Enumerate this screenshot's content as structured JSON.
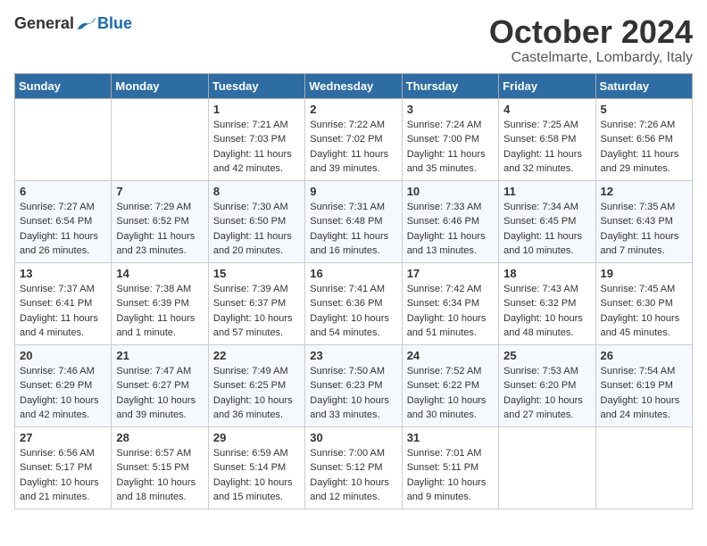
{
  "header": {
    "logo_general": "General",
    "logo_blue": "Blue",
    "month_title": "October 2024",
    "location": "Castelmarte, Lombardy, Italy"
  },
  "days_of_week": [
    "Sunday",
    "Monday",
    "Tuesday",
    "Wednesday",
    "Thursday",
    "Friday",
    "Saturday"
  ],
  "weeks": [
    [
      {
        "day": "",
        "sunrise": "",
        "sunset": "",
        "daylight": ""
      },
      {
        "day": "",
        "sunrise": "",
        "sunset": "",
        "daylight": ""
      },
      {
        "day": "1",
        "sunrise": "Sunrise: 7:21 AM",
        "sunset": "Sunset: 7:03 PM",
        "daylight": "Daylight: 11 hours and 42 minutes."
      },
      {
        "day": "2",
        "sunrise": "Sunrise: 7:22 AM",
        "sunset": "Sunset: 7:02 PM",
        "daylight": "Daylight: 11 hours and 39 minutes."
      },
      {
        "day": "3",
        "sunrise": "Sunrise: 7:24 AM",
        "sunset": "Sunset: 7:00 PM",
        "daylight": "Daylight: 11 hours and 35 minutes."
      },
      {
        "day": "4",
        "sunrise": "Sunrise: 7:25 AM",
        "sunset": "Sunset: 6:58 PM",
        "daylight": "Daylight: 11 hours and 32 minutes."
      },
      {
        "day": "5",
        "sunrise": "Sunrise: 7:26 AM",
        "sunset": "Sunset: 6:56 PM",
        "daylight": "Daylight: 11 hours and 29 minutes."
      }
    ],
    [
      {
        "day": "6",
        "sunrise": "Sunrise: 7:27 AM",
        "sunset": "Sunset: 6:54 PM",
        "daylight": "Daylight: 11 hours and 26 minutes."
      },
      {
        "day": "7",
        "sunrise": "Sunrise: 7:29 AM",
        "sunset": "Sunset: 6:52 PM",
        "daylight": "Daylight: 11 hours and 23 minutes."
      },
      {
        "day": "8",
        "sunrise": "Sunrise: 7:30 AM",
        "sunset": "Sunset: 6:50 PM",
        "daylight": "Daylight: 11 hours and 20 minutes."
      },
      {
        "day": "9",
        "sunrise": "Sunrise: 7:31 AM",
        "sunset": "Sunset: 6:48 PM",
        "daylight": "Daylight: 11 hours and 16 minutes."
      },
      {
        "day": "10",
        "sunrise": "Sunrise: 7:33 AM",
        "sunset": "Sunset: 6:46 PM",
        "daylight": "Daylight: 11 hours and 13 minutes."
      },
      {
        "day": "11",
        "sunrise": "Sunrise: 7:34 AM",
        "sunset": "Sunset: 6:45 PM",
        "daylight": "Daylight: 11 hours and 10 minutes."
      },
      {
        "day": "12",
        "sunrise": "Sunrise: 7:35 AM",
        "sunset": "Sunset: 6:43 PM",
        "daylight": "Daylight: 11 hours and 7 minutes."
      }
    ],
    [
      {
        "day": "13",
        "sunrise": "Sunrise: 7:37 AM",
        "sunset": "Sunset: 6:41 PM",
        "daylight": "Daylight: 11 hours and 4 minutes."
      },
      {
        "day": "14",
        "sunrise": "Sunrise: 7:38 AM",
        "sunset": "Sunset: 6:39 PM",
        "daylight": "Daylight: 11 hours and 1 minute."
      },
      {
        "day": "15",
        "sunrise": "Sunrise: 7:39 AM",
        "sunset": "Sunset: 6:37 PM",
        "daylight": "Daylight: 10 hours and 57 minutes."
      },
      {
        "day": "16",
        "sunrise": "Sunrise: 7:41 AM",
        "sunset": "Sunset: 6:36 PM",
        "daylight": "Daylight: 10 hours and 54 minutes."
      },
      {
        "day": "17",
        "sunrise": "Sunrise: 7:42 AM",
        "sunset": "Sunset: 6:34 PM",
        "daylight": "Daylight: 10 hours and 51 minutes."
      },
      {
        "day": "18",
        "sunrise": "Sunrise: 7:43 AM",
        "sunset": "Sunset: 6:32 PM",
        "daylight": "Daylight: 10 hours and 48 minutes."
      },
      {
        "day": "19",
        "sunrise": "Sunrise: 7:45 AM",
        "sunset": "Sunset: 6:30 PM",
        "daylight": "Daylight: 10 hours and 45 minutes."
      }
    ],
    [
      {
        "day": "20",
        "sunrise": "Sunrise: 7:46 AM",
        "sunset": "Sunset: 6:29 PM",
        "daylight": "Daylight: 10 hours and 42 minutes."
      },
      {
        "day": "21",
        "sunrise": "Sunrise: 7:47 AM",
        "sunset": "Sunset: 6:27 PM",
        "daylight": "Daylight: 10 hours and 39 minutes."
      },
      {
        "day": "22",
        "sunrise": "Sunrise: 7:49 AM",
        "sunset": "Sunset: 6:25 PM",
        "daylight": "Daylight: 10 hours and 36 minutes."
      },
      {
        "day": "23",
        "sunrise": "Sunrise: 7:50 AM",
        "sunset": "Sunset: 6:23 PM",
        "daylight": "Daylight: 10 hours and 33 minutes."
      },
      {
        "day": "24",
        "sunrise": "Sunrise: 7:52 AM",
        "sunset": "Sunset: 6:22 PM",
        "daylight": "Daylight: 10 hours and 30 minutes."
      },
      {
        "day": "25",
        "sunrise": "Sunrise: 7:53 AM",
        "sunset": "Sunset: 6:20 PM",
        "daylight": "Daylight: 10 hours and 27 minutes."
      },
      {
        "day": "26",
        "sunrise": "Sunrise: 7:54 AM",
        "sunset": "Sunset: 6:19 PM",
        "daylight": "Daylight: 10 hours and 24 minutes."
      }
    ],
    [
      {
        "day": "27",
        "sunrise": "Sunrise: 6:56 AM",
        "sunset": "Sunset: 5:17 PM",
        "daylight": "Daylight: 10 hours and 21 minutes."
      },
      {
        "day": "28",
        "sunrise": "Sunrise: 6:57 AM",
        "sunset": "Sunset: 5:15 PM",
        "daylight": "Daylight: 10 hours and 18 minutes."
      },
      {
        "day": "29",
        "sunrise": "Sunrise: 6:59 AM",
        "sunset": "Sunset: 5:14 PM",
        "daylight": "Daylight: 10 hours and 15 minutes."
      },
      {
        "day": "30",
        "sunrise": "Sunrise: 7:00 AM",
        "sunset": "Sunset: 5:12 PM",
        "daylight": "Daylight: 10 hours and 12 minutes."
      },
      {
        "day": "31",
        "sunrise": "Sunrise: 7:01 AM",
        "sunset": "Sunset: 5:11 PM",
        "daylight": "Daylight: 10 hours and 9 minutes."
      },
      {
        "day": "",
        "sunrise": "",
        "sunset": "",
        "daylight": ""
      },
      {
        "day": "",
        "sunrise": "",
        "sunset": "",
        "daylight": ""
      }
    ]
  ]
}
